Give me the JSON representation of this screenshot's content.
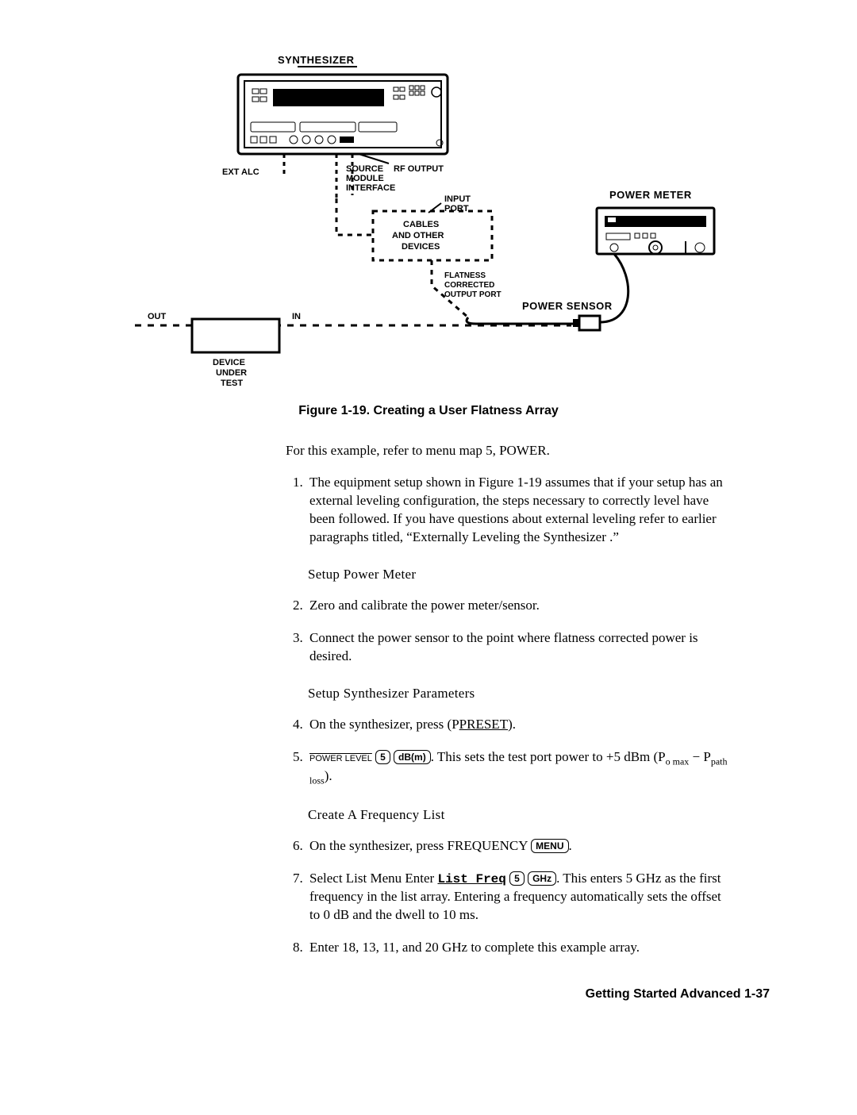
{
  "diagram": {
    "title_synth": "SYNTHESIZER",
    "ext_alc": "EXT ALC",
    "source_module": "SOURCE MODULE INTERFACE",
    "rf_output": "RF  OUTPUT",
    "input_port": "INPUT PORT",
    "cables": "CABLES AND OTHER DEVICES",
    "flatness": "FLATNESS CORRECTED OUTPUT PORT",
    "power_meter": "POWER METER",
    "power_sensor": "POWER SENSOR",
    "out": "OUT",
    "in": "IN",
    "dut": "DEVICE UNDER TEST"
  },
  "caption": "Figure 1-19. Creating a User Flatness Array",
  "intro": "For this example, refer to menu map 5, POWER.",
  "step1": "The equipment setup shown in Figure 1-19 assumes that if your setup has an external leveling configuration, the steps necessary to correctly level have been followed. If you have questions about external leveling refer to earlier paragraphs titled, “Externally Leveling the Synthesizer .”",
  "sub_pm": "Setup Power Meter",
  "step2": "Zero and calibrate the power meter/sensor.",
  "step3": "Connect the power sensor to the point where flatness corrected power is desired.",
  "sub_syn": "Setup Synthesizer Parameters",
  "step4_a": "On the synthesizer, press (",
  "step4_preset": "PRESET",
  "step4_b": ").",
  "step5": {
    "power": "POWER LEVEL",
    "five": "5",
    "dbm": "dB(m)",
    "tail_a": ". This sets the test port power to +5 dBm (P",
    "sub1": "o max",
    "minus": " − P",
    "sub2": "path loss",
    "tail_b": ")."
  },
  "sub_freq": "Create A Frequency List",
  "step6_a": "On the synthesizer, press FREQUENCY ",
  "step6_key": "MENU",
  "step6_b": ".",
  "step7": {
    "a": "Select List Menu Enter ",
    "soft": "List Freq",
    "five": "5",
    "ghz": "GHz",
    "b": ". This enters 5 GHz as the first frequency in the list array. Entering a frequency automatically sets the offset to 0 dB and the dwell to 10 ms."
  },
  "step8": "Enter 18, 13, 11, and 20 GHz to complete this example array.",
  "footer": "Getting Started Advanced 1-37"
}
